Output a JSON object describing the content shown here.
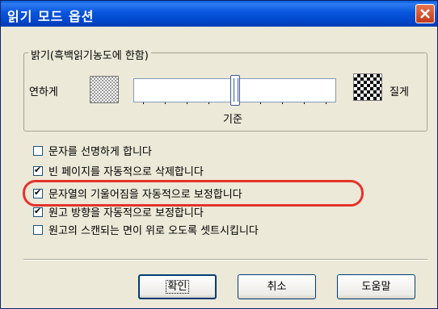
{
  "window": {
    "title": "읽기 모드 옵션"
  },
  "brightness": {
    "group_label": "밝기(흑백읽기농도에 한함)",
    "light_label": "연하게",
    "dark_label": "질게",
    "center_label": "기준",
    "level": 0.5
  },
  "options": [
    {
      "label": "문자를 선명하게 합니다",
      "checked": false
    },
    {
      "label": "빈 페이지를 자동적으로 삭제합니다",
      "checked": true
    },
    {
      "label": "문자열의 기울어짐을 자동적으로 보정합니다",
      "checked": true
    },
    {
      "label": "원고 방향을 자동적으로 보정합니다",
      "checked": true
    },
    {
      "label": "원고의 스캔되는 면이 위로 오도록 셋트시킵니다",
      "checked": false
    }
  ],
  "buttons": {
    "ok": "확인",
    "cancel": "취소",
    "help": "도움말"
  },
  "colors": {
    "title_bar": "#0A5FD9",
    "dialog_bg": "#ECE9D8",
    "highlight": "#E4332C"
  }
}
